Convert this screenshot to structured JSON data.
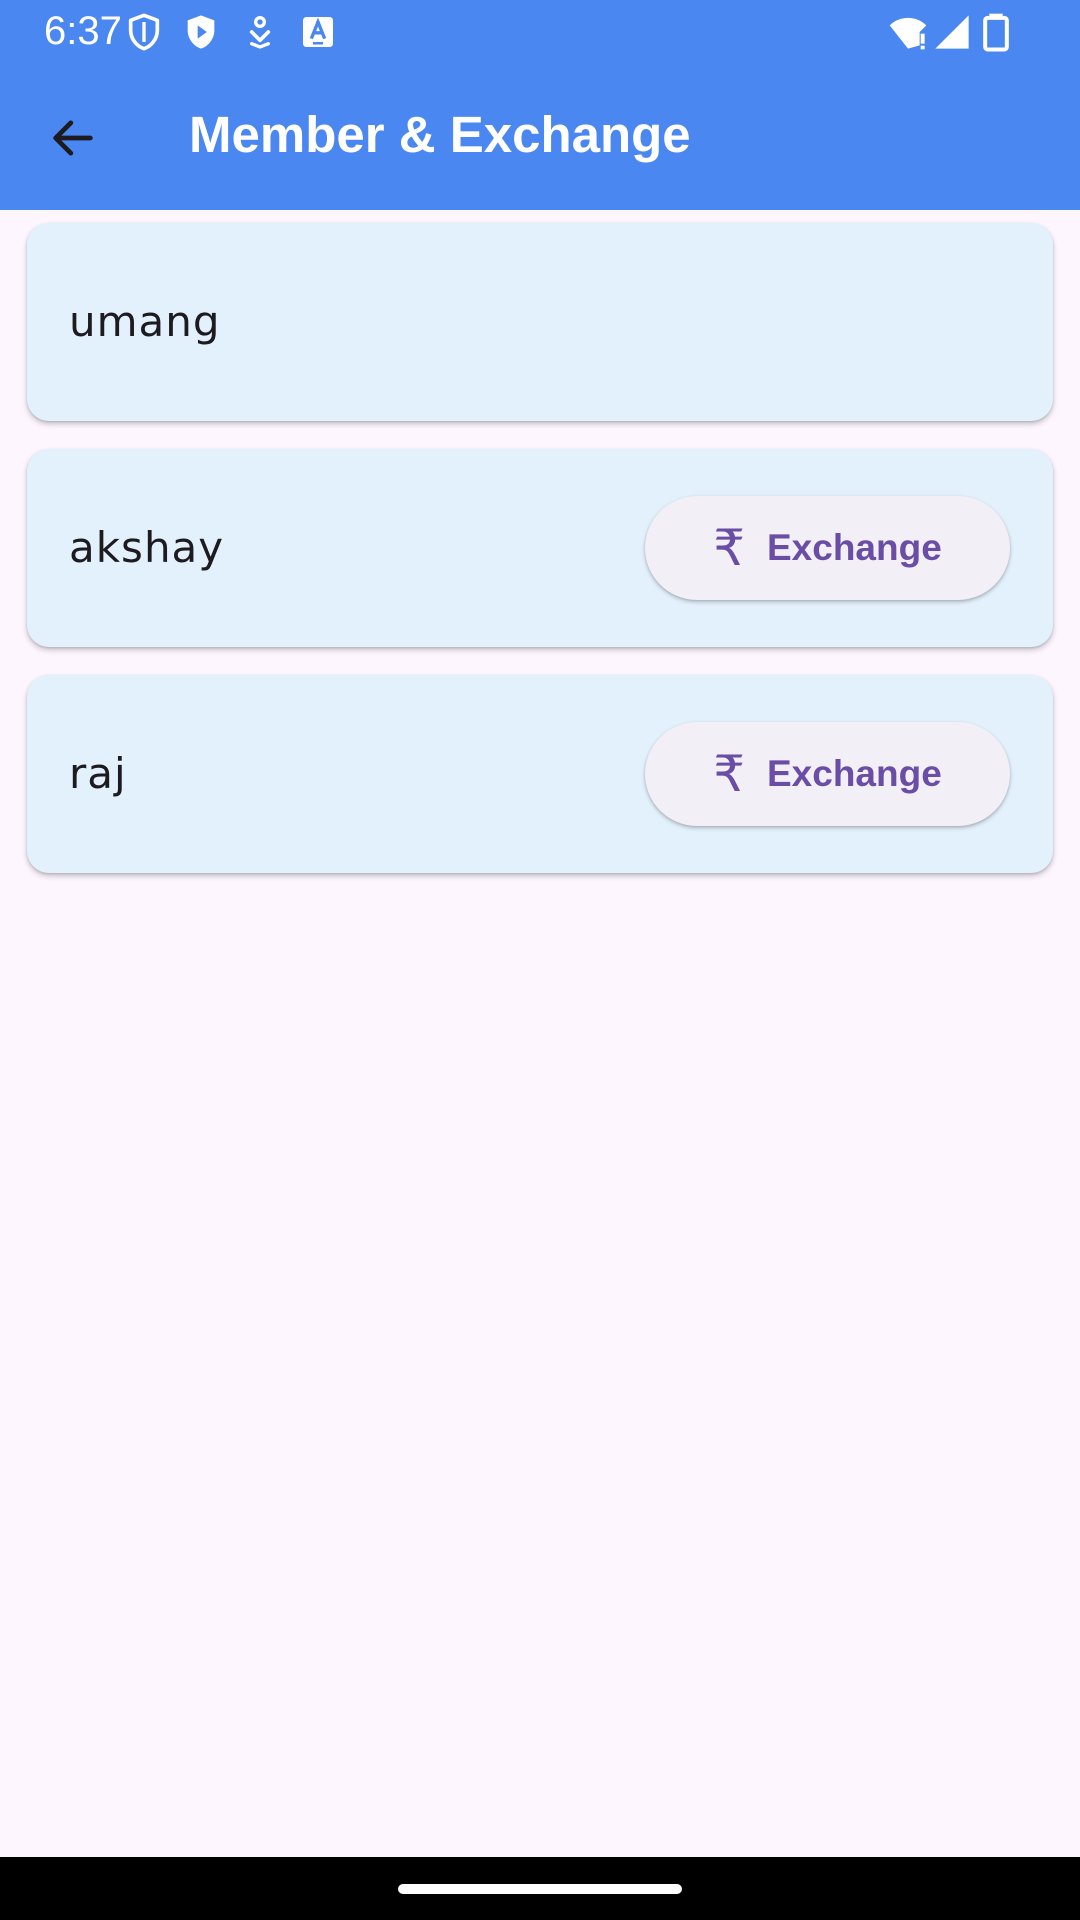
{
  "status_bar": {
    "time": "6:37",
    "left_icons": [
      "shield-outline-icon",
      "shield-play-icon",
      "download-icon",
      "text-a-icon"
    ],
    "right_icons": [
      "wifi-alert-icon",
      "signal-icon",
      "battery-icon"
    ]
  },
  "app_bar": {
    "back_icon": "arrow-back-icon",
    "title": "Member & Exchange"
  },
  "members": [
    {
      "name": "umang",
      "exchange_label": ""
    },
    {
      "name": "akshay",
      "exchange_label": "Exchange"
    },
    {
      "name": "raj",
      "exchange_label": "Exchange"
    }
  ],
  "exchange_icon": "₹",
  "colors": {
    "app_bar": "#4a87f1",
    "card_background": "#e3f1fd",
    "accent": "#6a4ea6",
    "page_background": "#fdf6fe"
  }
}
